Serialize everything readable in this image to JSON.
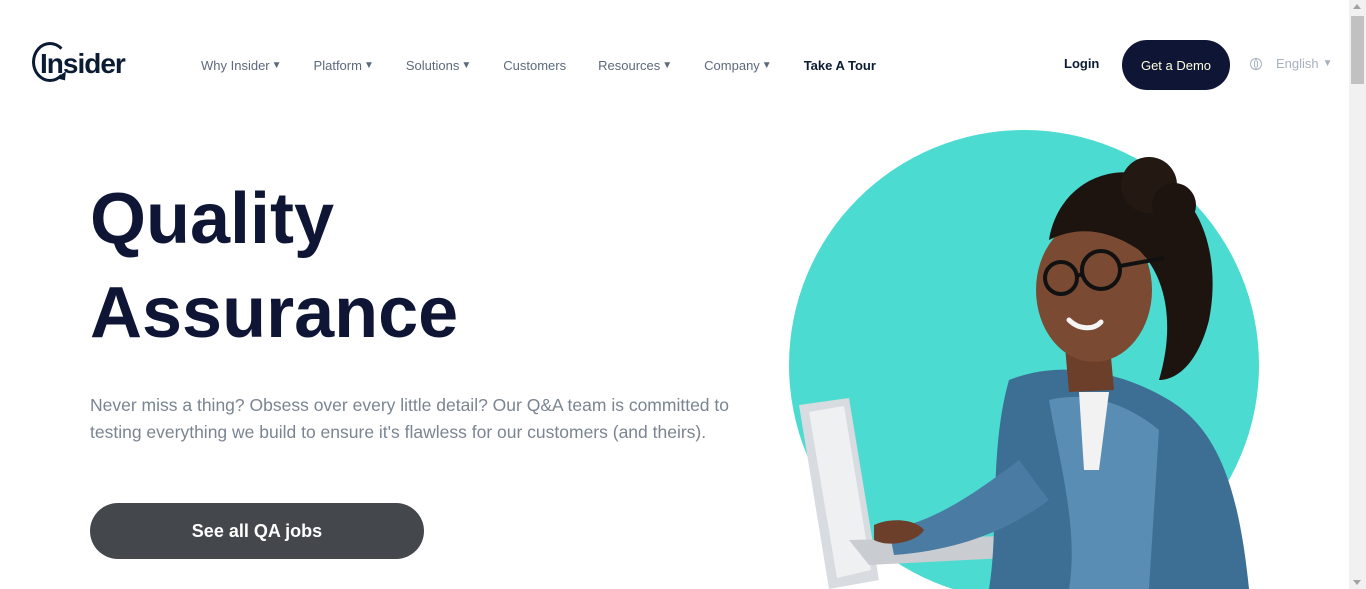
{
  "header": {
    "logo_text": "Insider",
    "nav": [
      {
        "label": "Why Insider",
        "dropdown": true
      },
      {
        "label": "Platform",
        "dropdown": true
      },
      {
        "label": "Solutions",
        "dropdown": true
      },
      {
        "label": "Customers",
        "dropdown": false
      },
      {
        "label": "Resources",
        "dropdown": true
      },
      {
        "label": "Company",
        "dropdown": true
      }
    ],
    "tour_label": "Take A Tour",
    "login_label": "Login",
    "demo_label": "Get a Demo",
    "language_label": "English"
  },
  "hero": {
    "title_line1": "Quality",
    "title_line2": "Assurance",
    "description": "Never miss a thing? Obsess over every little detail? Our Q&A team is committed to testing everything we build to ensure it's flawless for our customers (and theirs).",
    "cta_label": "See all QA jobs"
  },
  "colors": {
    "brand_navy": "#0e1535",
    "accent_teal": "#4cdbd0",
    "cta_gray": "#44474c"
  },
  "icons": {
    "dropdown": "caret-down-icon",
    "language": "globe-icon"
  }
}
